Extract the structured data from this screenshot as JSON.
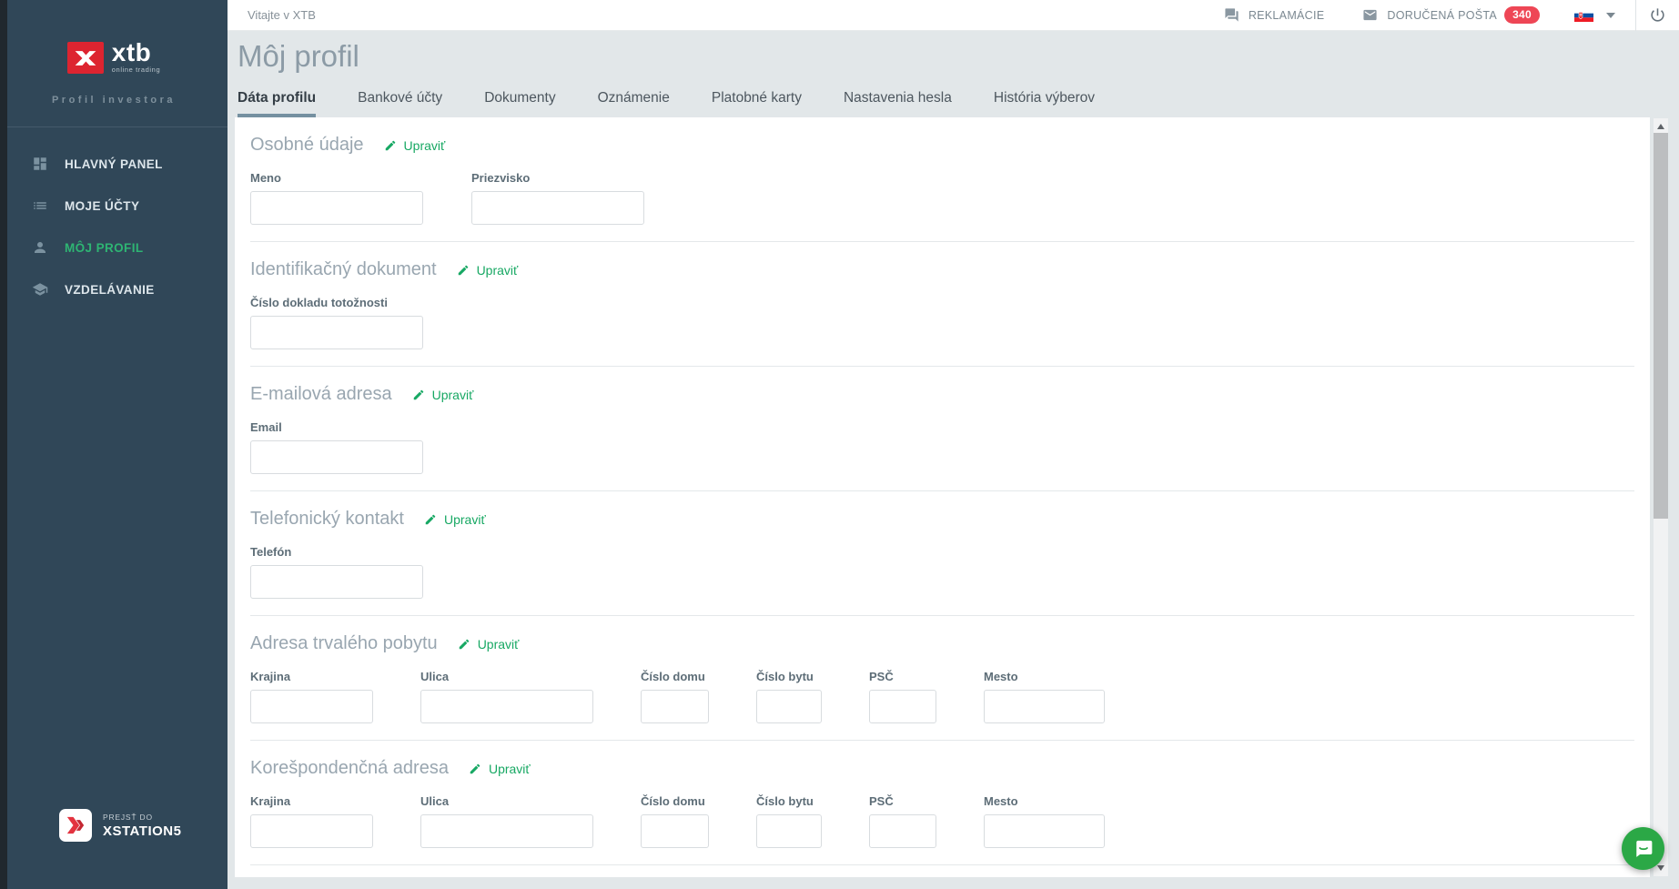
{
  "sidebar": {
    "brand": {
      "name": "xtb",
      "tagline": "online trading"
    },
    "subtitle": "Profil investora",
    "items": [
      {
        "label": "HLAVNÝ PANEL",
        "icon": "dashboard-icon",
        "active": false
      },
      {
        "label": "MOJE ÚČTY",
        "icon": "list-icon",
        "active": false
      },
      {
        "label": "MÔJ PROFIL",
        "icon": "person-icon",
        "active": true
      },
      {
        "label": "VZDELÁVANIE",
        "icon": "education-icon",
        "active": false
      }
    ],
    "xstation": {
      "pre": "PREJSŤ DO",
      "name": "XSTATION5"
    }
  },
  "topbar": {
    "welcome": "Vitajte v XTB",
    "complaints": "REKLAMÁCIE",
    "inbox": "DORUČENÁ POŠTA",
    "inbox_badge": "340",
    "language_flag": "slovakia"
  },
  "header": {
    "title": "Môj profil",
    "tabs": [
      {
        "label": "Dáta profilu",
        "active": true
      },
      {
        "label": "Bankové účty",
        "active": false
      },
      {
        "label": "Dokumenty",
        "active": false
      },
      {
        "label": "Oznámenie",
        "active": false
      },
      {
        "label": "Platobné karty",
        "active": false
      },
      {
        "label": "Nastavenia hesla",
        "active": false
      },
      {
        "label": "História výberov",
        "active": false
      }
    ]
  },
  "sections": [
    {
      "title": "Osobné údaje",
      "edit": "Upraviť",
      "fields": [
        {
          "label": "Meno",
          "value": ""
        },
        {
          "label": "Priezvisko",
          "value": ""
        }
      ]
    },
    {
      "title": "Identifikačný dokument",
      "edit": "Upraviť",
      "fields": [
        {
          "label": "Číslo dokladu totožnosti",
          "value": ""
        }
      ]
    },
    {
      "title": "E-mailová adresa",
      "edit": "Upraviť",
      "fields": [
        {
          "label": "Email",
          "value": ""
        }
      ]
    },
    {
      "title": "Telefonický kontakt",
      "edit": "Upraviť",
      "fields": [
        {
          "label": "Telefón",
          "value": ""
        }
      ]
    },
    {
      "title": "Adresa trvalého pobytu",
      "edit": "Upraviť",
      "fields": [
        {
          "label": "Krajina",
          "value": ""
        },
        {
          "label": "Ulica",
          "value": ""
        },
        {
          "label": "Číslo domu",
          "value": ""
        },
        {
          "label": "Číslo bytu",
          "value": ""
        },
        {
          "label": "PSČ",
          "value": ""
        },
        {
          "label": "Mesto",
          "value": ""
        }
      ]
    },
    {
      "title": "Korešpondenčná adresa",
      "edit": "Upraviť",
      "fields": [
        {
          "label": "Krajina",
          "value": ""
        },
        {
          "label": "Ulica",
          "value": ""
        },
        {
          "label": "Číslo domu",
          "value": ""
        },
        {
          "label": "Číslo bytu",
          "value": ""
        },
        {
          "label": "PSČ",
          "value": ""
        },
        {
          "label": "Mesto",
          "value": ""
        }
      ]
    }
  ],
  "colors": {
    "sidebar_navy": "#304758",
    "accent_green": "#17a863",
    "nav_active_green": "#2eb573",
    "badge_red": "#ee4655",
    "tab_underline": "#7590a0",
    "chat_button_green": "#2ba846",
    "brand_red": "#dd2430"
  }
}
